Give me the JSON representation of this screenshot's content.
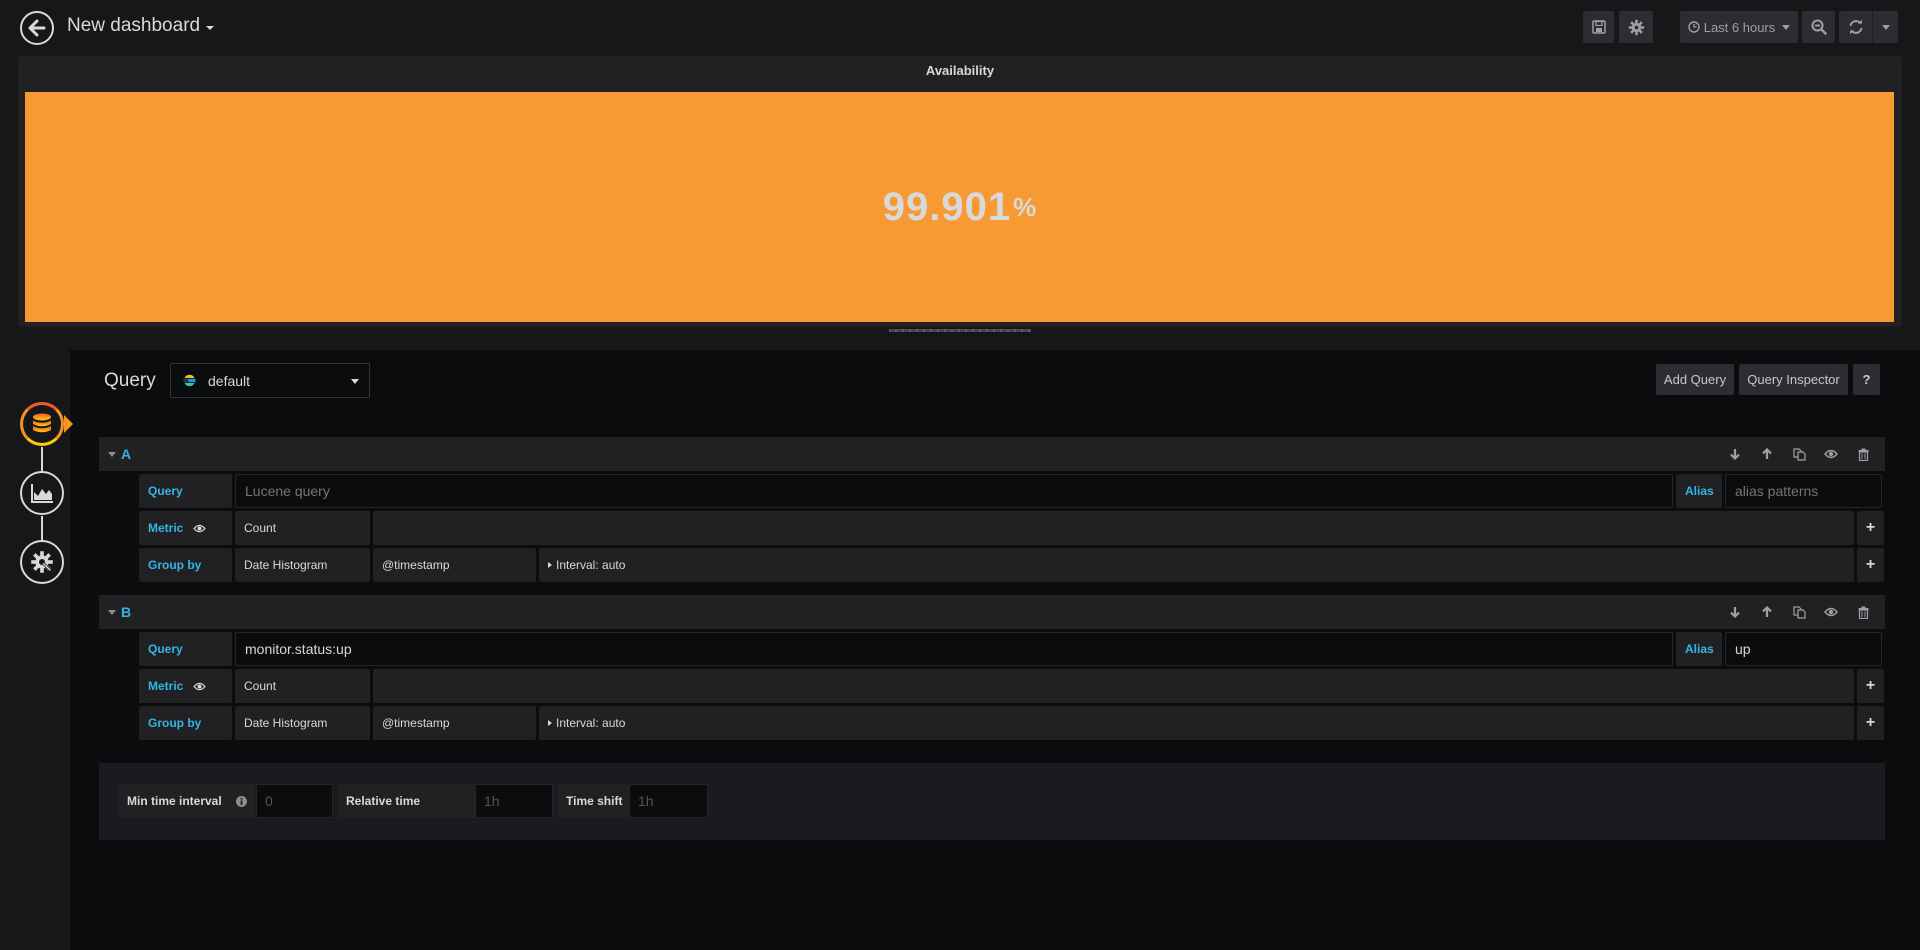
{
  "navbar": {
    "title": "New dashboard",
    "time_range": "Last 6 hours",
    "icons": {
      "back": "arrow-left-icon",
      "save": "save-icon",
      "settings": "gear-icon",
      "clock": "clock-icon",
      "zoom_out": "zoom-out-icon",
      "refresh": "refresh-icon",
      "refresh_dropdown": "chevron-down-icon"
    }
  },
  "panel": {
    "title": "Availability",
    "value": "99.901",
    "unit": "%",
    "background_color": "#f79a34"
  },
  "editor": {
    "section_label": "Query",
    "datasource": "default",
    "buttons": {
      "add_query": "Add Query",
      "query_inspector": "Query Inspector",
      "help": "?"
    },
    "steps": [
      "queries",
      "visualization",
      "general"
    ],
    "queries": [
      {
        "ref_id": "A",
        "query_label": "Query",
        "query_value": "",
        "query_placeholder": "Lucene query",
        "alias_label": "Alias",
        "alias_value": "",
        "alias_placeholder": "alias patterns",
        "metric_label": "Metric",
        "metric_value": "Count",
        "group_label": "Group by",
        "group_type": "Date Histogram",
        "group_field": "@timestamp",
        "group_interval": "Interval: auto"
      },
      {
        "ref_id": "B",
        "query_label": "Query",
        "query_value": "monitor.status:up",
        "query_placeholder": "Lucene query",
        "alias_label": "Alias",
        "alias_value": "up",
        "alias_placeholder": "alias patterns",
        "metric_label": "Metric",
        "metric_value": "Count",
        "group_label": "Group by",
        "group_type": "Date Histogram",
        "group_field": "@timestamp",
        "group_interval": "Interval: auto"
      }
    ],
    "options": {
      "min_interval_label": "Min time interval",
      "min_interval_placeholder": "0",
      "relative_time_label": "Relative time",
      "relative_time_placeholder": "1h",
      "time_shift_label": "Time shift",
      "time_shift_placeholder": "1h"
    }
  },
  "colors": {
    "accent_blue": "#33b5e5",
    "stat_orange": "#f79a34",
    "background": "#161719",
    "panel_bg": "#212124",
    "editor_bg": "#0b0c0e"
  }
}
